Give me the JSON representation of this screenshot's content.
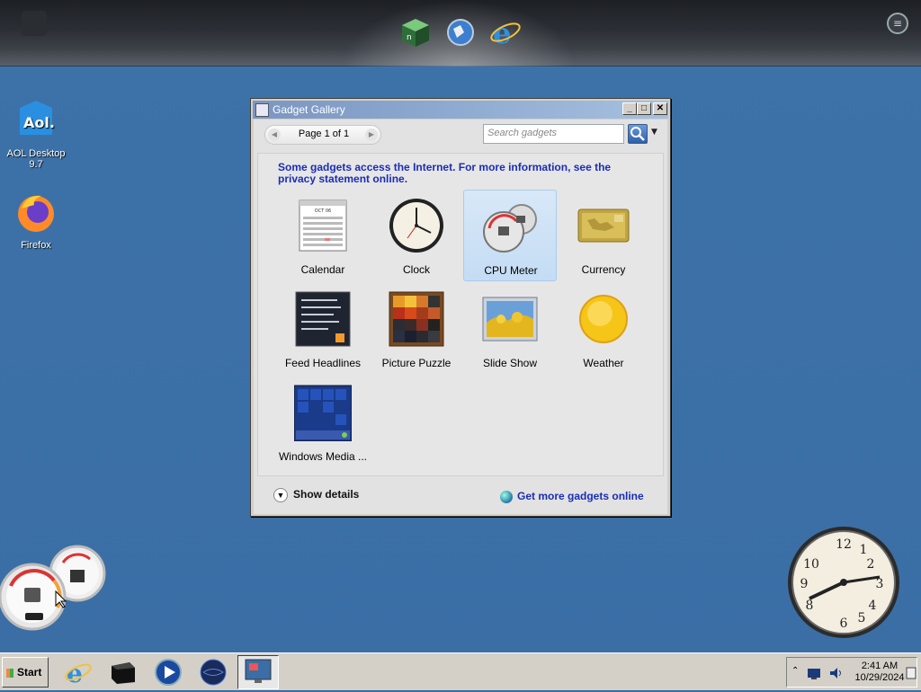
{
  "desktop": {
    "icons": [
      {
        "label": "AOL Desktop 9.7"
      },
      {
        "label": "Firefox"
      }
    ]
  },
  "window": {
    "title": "Gadget Gallery",
    "pager_text": "Page 1 of 1",
    "search_placeholder": "Search gadgets",
    "notice": "Some gadgets access the Internet.  For more information, see the privacy statement online.",
    "gadgets": [
      {
        "label": "Calendar",
        "icon": "calendar-icon",
        "selected": false
      },
      {
        "label": "Clock",
        "icon": "clock-icon",
        "selected": false
      },
      {
        "label": "CPU Meter",
        "icon": "cpu-meter-icon",
        "selected": true
      },
      {
        "label": "Currency",
        "icon": "currency-icon",
        "selected": false
      },
      {
        "label": "Feed Headlines",
        "icon": "feed-headlines-icon",
        "selected": false
      },
      {
        "label": "Picture Puzzle",
        "icon": "picture-puzzle-icon",
        "selected": false
      },
      {
        "label": "Slide Show",
        "icon": "slide-show-icon",
        "selected": false
      },
      {
        "label": "Weather",
        "icon": "weather-icon",
        "selected": false
      },
      {
        "label": "Windows Media ...",
        "icon": "windows-media-icon",
        "selected": false
      }
    ],
    "show_details": "Show details",
    "get_more": "Get more gadgets online",
    "calendar_month": "OCT 06"
  },
  "taskbar": {
    "start_label": "Start",
    "time": "2:41 AM",
    "date": "10/29/2024"
  },
  "colors": {
    "desktop": "#3a6ea5",
    "link": "#1a2db8",
    "selection": "#c4dcf4"
  }
}
